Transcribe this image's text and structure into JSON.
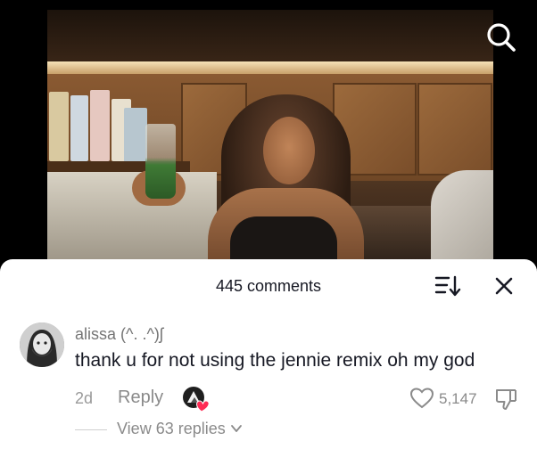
{
  "video": {
    "search_icon": "search-icon"
  },
  "comments_panel": {
    "count_label": "445 comments",
    "sort_icon": "sort-icon",
    "close_icon": "close-icon"
  },
  "comment": {
    "username": "alissa (^. .^)ʃ",
    "text": "thank u for not using the jennie remix oh my god",
    "time": "2d",
    "reply_label": "Reply",
    "like_count": "5,147",
    "view_replies_label": "View 63 replies",
    "icons": {
      "creator_liked": "creator-liked-icon",
      "like": "heart-icon",
      "dislike": "dislike-icon",
      "expand": "chevron-down-icon"
    }
  },
  "colors": {
    "sheet_bg": "#ffffff",
    "primary_text": "#161823",
    "secondary_text": "#8a8a8a",
    "heart_badge": "#fe2c55"
  }
}
